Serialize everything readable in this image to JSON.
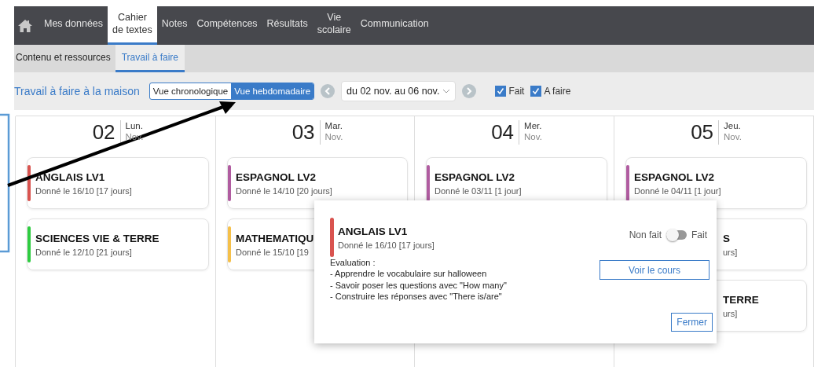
{
  "nav": {
    "items": [
      {
        "kind": "home",
        "selected": false
      },
      {
        "kind": "text",
        "label": "Mes données",
        "selected": false
      },
      {
        "kind": "text",
        "label": "Cahier\nde textes",
        "selected": true
      },
      {
        "kind": "text",
        "label": "Notes",
        "selected": false
      },
      {
        "kind": "text",
        "label": "Compétences",
        "selected": false
      },
      {
        "kind": "text",
        "label": "Résultats",
        "selected": false
      },
      {
        "kind": "text",
        "label": "Vie\nscolaire",
        "selected": false
      },
      {
        "kind": "text",
        "label": "Communication",
        "selected": false
      }
    ]
  },
  "subtabs": [
    {
      "label": "Contenu et ressources",
      "selected": false
    },
    {
      "label": "Travail à faire",
      "selected": true
    }
  ],
  "toolbar": {
    "title": "Travail à faire à la maison",
    "views": [
      {
        "label": "Vue chronologique",
        "selected": false
      },
      {
        "label": "Vue hebdomadaire",
        "selected": true
      }
    ],
    "date_range": "du 02 nov. au 06 nov.",
    "filters": [
      {
        "label": "Fait",
        "checked": true
      },
      {
        "label": "A faire",
        "checked": true
      }
    ]
  },
  "days": [
    {
      "day": "02",
      "weekday": "Lun.",
      "month": "Nov.",
      "cards": [
        {
          "kind": "full",
          "subject": "ANGLAIS LV1",
          "given": "Donné le 16/10 [17 jours]",
          "color": "#d9534f"
        },
        {
          "kind": "full",
          "subject": "SCIENCES VIE & TERRE",
          "given": "Donné le 12/10 [21 jours]",
          "color": "#2ecc40"
        }
      ]
    },
    {
      "day": "03",
      "weekday": "Mar.",
      "month": "Nov.",
      "cards": [
        {
          "kind": "full",
          "subject": "ESPAGNOL LV2",
          "given": "Donné le 14/10 [20 jours]",
          "color": "#b05ca0"
        },
        {
          "kind": "full",
          "subject": "MATHEMATIQU",
          "given": "Donné le 15/10 [19",
          "color": "#f5c04a"
        }
      ]
    },
    {
      "day": "04",
      "weekday": "Mer.",
      "month": "Nov.",
      "cards": [
        {
          "kind": "full",
          "subject": "ESPAGNOL LV2",
          "given": "Donné le 03/11 [1 jour]",
          "color": "#b05ca0"
        }
      ]
    },
    {
      "day": "05",
      "weekday": "Jeu.",
      "month": "Nov.",
      "cards": [
        {
          "kind": "full",
          "subject": "ESPAGNOL LV2",
          "given": "Donné le 04/11 [1 jour]",
          "color": "#b05ca0"
        },
        {
          "kind": "covered",
          "subject": "S",
          "given": "urs]"
        },
        {
          "kind": "covered",
          "subject": "TERRE",
          "given": "urs]"
        }
      ]
    }
  ],
  "popup": {
    "subject": "ANGLAIS LV1",
    "given": "Donné le 16/10 [17 jours]",
    "color": "#d9534f",
    "lines": [
      "Evaluation :",
      "- Apprendre le vocabulaire sur halloween",
      "- Savoir poser les questions avec \"How many\"",
      "- Construire les réponses avec \"There is/are\""
    ],
    "toggle": {
      "off_label": "Non fait",
      "on_label": "Fait",
      "on": false
    },
    "course_button": "Voir le cours",
    "close_button": "Fermer"
  }
}
